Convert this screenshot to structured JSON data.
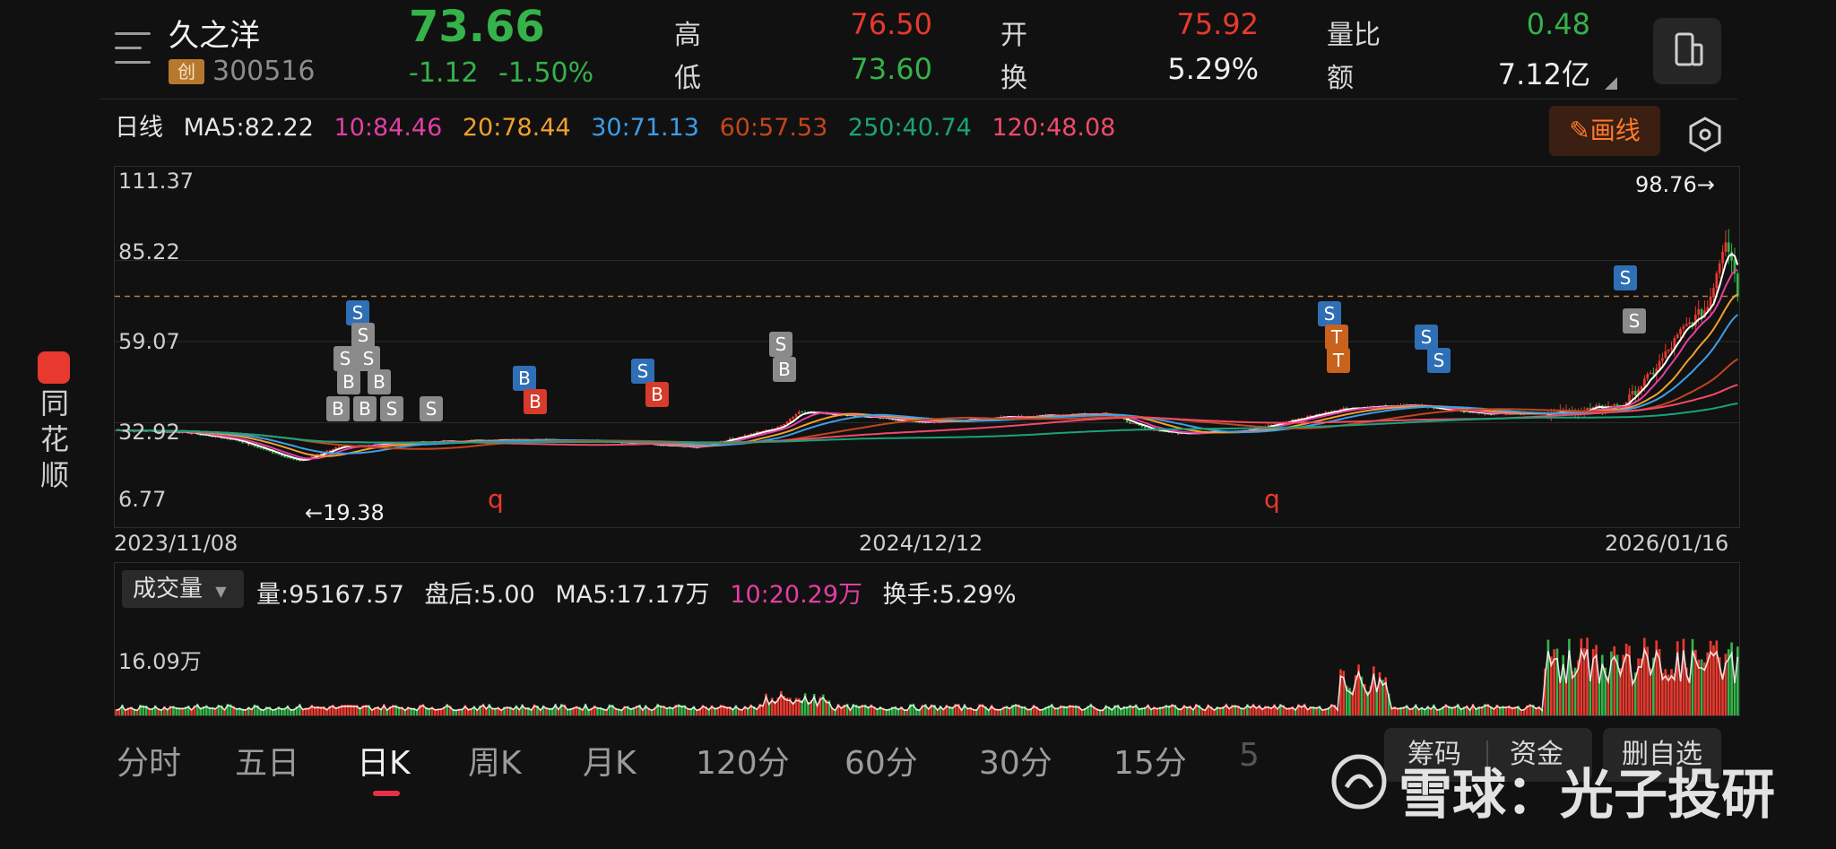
{
  "header": {
    "name": "久之洋",
    "board": "创",
    "code": "300516",
    "price": "73.66",
    "change": "-1.12",
    "change_pct": "-1.50%",
    "high_label": "高",
    "high": "76.50",
    "low_label": "低",
    "low": "73.60",
    "open_label": "开",
    "open": "75.92",
    "turnover_label": "换",
    "turnover": "5.29%",
    "vol_ratio_label": "量比",
    "vol_ratio": "0.48",
    "amount_label": "额",
    "amount": "7.12亿",
    "up_color": "#e8392e",
    "down_color": "#35b24a"
  },
  "ma_bar": {
    "period": "日线",
    "items": [
      {
        "text": "MA5:82.22",
        "color": "#e6e6e6"
      },
      {
        "text": "10:84.46",
        "color": "#e23fa5"
      },
      {
        "text": "20:78.44",
        "color": "#f0a02c"
      },
      {
        "text": "30:71.13",
        "color": "#3d9ee8"
      },
      {
        "text": "60:57.53",
        "color": "#c2461c"
      },
      {
        "text": "250:40.74",
        "color": "#1aa37a"
      },
      {
        "text": "120:48.08",
        "color": "#f04a6b"
      }
    ],
    "draw_button": "画线"
  },
  "chart": {
    "y_labels": [
      "111.37",
      "85.22",
      "59.07",
      "32.92",
      "6.77"
    ],
    "x_labels": [
      "2023/11/08",
      "2024/12/12",
      "2026/01/16"
    ],
    "high_marker": "98.76→",
    "low_marker": "←19.38",
    "signals": [
      "S",
      "S",
      "S",
      "S",
      "B",
      "B",
      "B",
      "B",
      "S",
      "S",
      "B",
      "B",
      "S",
      "B",
      "S",
      "B",
      "S",
      "T",
      "T",
      "S",
      "S",
      "S",
      "S"
    ]
  },
  "chart_data": {
    "type": "candlestick",
    "y_range": [
      6.77,
      111.37
    ],
    "x_range": [
      "2023/11/08",
      "2026/01/16"
    ],
    "max_label": 98.76,
    "min_label": 19.38,
    "last_close": 73.66,
    "moving_averages": {
      "MA5": 82.22,
      "MA10": 84.46,
      "MA20": 78.44,
      "MA30": 71.13,
      "MA60": 57.53,
      "MA250": 40.74,
      "MA120": 48.08
    },
    "close_trend": [
      [
        "2023/11/08",
        30.5
      ],
      [
        "2023/12/10",
        30.0
      ],
      [
        "2024/01/05",
        27.5
      ],
      [
        "2024/02/06",
        20.5
      ],
      [
        "2024/02/25",
        25.0
      ],
      [
        "2024/04/01",
        26.5
      ],
      [
        "2024/05/20",
        27.5
      ],
      [
        "2024/07/01",
        27.0
      ],
      [
        "2024/08/20",
        25.0
      ],
      [
        "2024/09/30",
        31.5
      ],
      [
        "2024/10/10",
        36.5
      ],
      [
        "2024/11/01",
        35.5
      ],
      [
        "2024/12/12",
        33.0
      ],
      [
        "2025/01/15",
        34.5
      ],
      [
        "2025/03/10",
        36.0
      ],
      [
        "2025/03/30",
        31.0
      ],
      [
        "2025/04/15",
        29.5
      ],
      [
        "2025/05/20",
        30.5
      ],
      [
        "2025/07/05",
        37.5
      ],
      [
        "2025/08/10",
        38.5
      ],
      [
        "2025/09/10",
        36.0
      ],
      [
        "2025/10/20",
        36.0
      ],
      [
        "2025/11/20",
        38.5
      ],
      [
        "2025/12/05",
        49.0
      ],
      [
        "2025/12/20",
        63.0
      ],
      [
        "2026/01/01",
        70.0
      ],
      [
        "2026/01/10",
        93.0
      ],
      [
        "2026/01/14",
        85.0
      ],
      [
        "2026/01/16",
        73.66
      ]
    ],
    "volume": {
      "latest": 95167.57,
      "after_hours": 5.0,
      "ma5": "17.17万",
      "ma10": "20.29万",
      "turnover": "5.29%",
      "axis_max": "16.09万"
    }
  },
  "volume_panel": {
    "selector": "成交量",
    "items": [
      {
        "text": "量:95167.57",
        "color": "#e6e6e6"
      },
      {
        "text": "盘后:5.00",
        "color": "#e6e6e6"
      },
      {
        "text": "MA5:17.17万",
        "color": "#e6e6e6"
      },
      {
        "text": "10:20.29万",
        "color": "#e23fa5"
      },
      {
        "text": "换手:5.29%",
        "color": "#e6e6e6"
      }
    ],
    "axis_label": "16.09万"
  },
  "tabs": [
    "分时",
    "五日",
    "日K",
    "周K",
    "月K",
    "120分",
    "60分",
    "30分",
    "15分",
    "5"
  ],
  "active_tab": "日K",
  "bottom_buttons": [
    "筹码",
    "资金",
    "删自选"
  ],
  "side_brand": "同花顺",
  "watermark": "雪球：光子投研"
}
